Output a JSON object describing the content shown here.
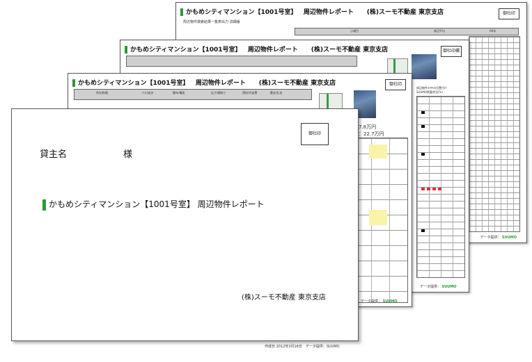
{
  "report_title": "かもめシティマンション【1001号室】 周辺物件レポート",
  "sheet_title_short": "かもめシティマンション【1001号室】",
  "sheet_report_label": "周辺物件レポート",
  "company": "(株)スーモ不動産 東京支店",
  "company_front": "(株)スーモ不動産 東京支店",
  "landlord_label": "貸主名",
  "honorific": "様",
  "stamp_label": "御社印",
  "stamp_label_back": "御社印欄",
  "search_summary": "周辺物件検索結果一覧表出力 詳細版",
  "rent_avg": "：7.8万円",
  "rent_range": "期：22.7万円",
  "data_source": "データ提供：",
  "brand": "SUUMO",
  "front_footer": "作成日 2012年3月16日　データ提供：SUUMO",
  "table_headers": [
    "所在地/駅",
    "バス/徒歩",
    "築年/構造",
    "広さ/間取り",
    "賃料/共益費",
    "敷金/礼金",
    "周辺の平均賃料"
  ],
  "right_headers": [
    "小項目",
    "周辺平均",
    "R6年"
  ],
  "small_labels": [
    "周辺物件の中の位置付け",
    "SUUMO掲載状況(%)"
  ]
}
